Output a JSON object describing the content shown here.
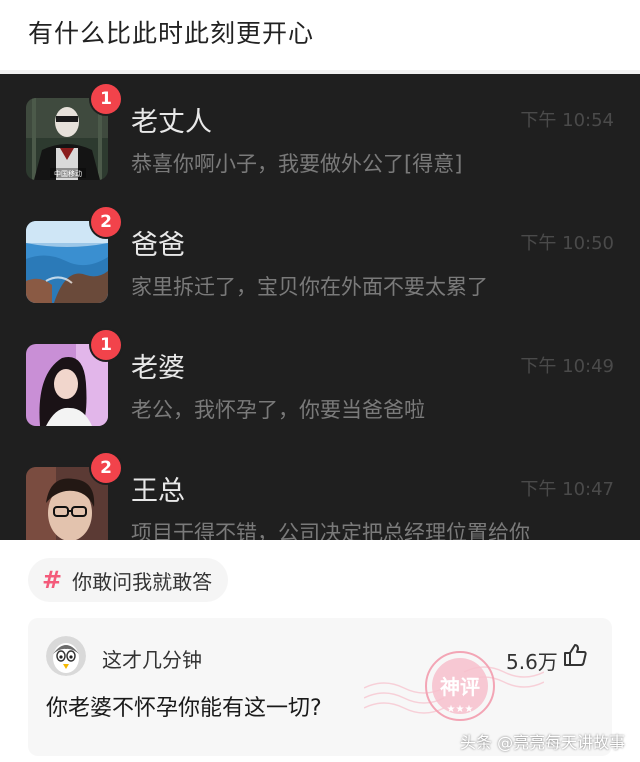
{
  "post": {
    "title": "有什么比此时此刻更开心"
  },
  "chat_screenshot": {
    "rows": [
      {
        "name": "老丈人",
        "time": "下午 10:54",
        "unread": "1",
        "preview": "恭喜你啊小子，我要做外公了[得意]",
        "avatar_caption": "中国移动"
      },
      {
        "name": "爸爸",
        "time": "下午 10:50",
        "unread": "2",
        "preview": "家里拆迁了，宝贝你在外面不要太累了"
      },
      {
        "name": "老婆",
        "time": "下午 10:49",
        "unread": "1",
        "preview": "老公，我怀孕了，你要当爸爸啦"
      },
      {
        "name": "王总",
        "time": "下午 10:47",
        "unread": "2",
        "preview": "项目干得不错，公司决定把总经理位置给你"
      }
    ]
  },
  "topic": {
    "symbol": "#",
    "text": "你敢问我就敢答"
  },
  "comment": {
    "username": "这才几分钟",
    "likes": "5.6万",
    "text": "你老婆不怀孕你能有这一切?",
    "stamp_text": "神评",
    "avatar_icon": "penguin-icon",
    "like_icon": "thumbs-up-icon"
  },
  "watermark": {
    "text": "头条 @亮亮每天讲故事"
  },
  "colors": {
    "badge": "#f2434b",
    "chat_background": "#1f1f1f",
    "topic_hash": "#f45a7a",
    "stamp": "#f3a5b5"
  }
}
